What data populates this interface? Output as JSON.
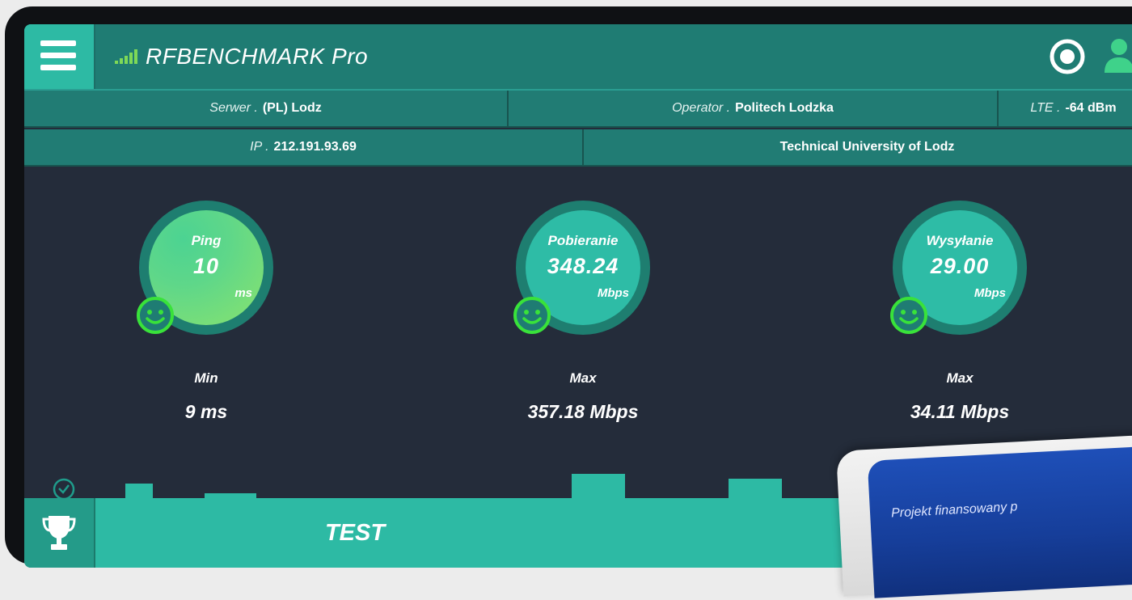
{
  "app": {
    "title": "RFBENCHMARK Pro"
  },
  "info": {
    "server_label": "Serwer .",
    "server_value": "(PL) Lodz",
    "operator_label": "Operator .",
    "operator_value": "Politech Lodzka",
    "network_label": "LTE .",
    "network_value": "-64 dBm",
    "ip_label": "IP .",
    "ip_value": "212.191.93.69",
    "isp_value": "Technical University of Lodz"
  },
  "gauges": [
    {
      "label": "Ping",
      "value": "10",
      "unit": "ms",
      "stat_label": "Min",
      "stat_value": "9 ms"
    },
    {
      "label": "Pobieranie",
      "value": "348.24",
      "unit": "Mbps",
      "stat_label": "Max",
      "stat_value": "357.18 Mbps"
    },
    {
      "label": "Wysyłanie",
      "value": "29.00",
      "unit": "Mbps",
      "stat_label": "Max",
      "stat_value": "34.11 Mbps"
    }
  ],
  "history": {
    "icon": "clock-icon"
  },
  "actions": {
    "test_label": "TEST",
    "trophy_icon": "trophy-icon"
  },
  "overlay": {
    "text": "Projekt finansowany p"
  },
  "colors": {
    "accent": "#2dbaa4",
    "header": "#1f7c73",
    "background": "#242c3a",
    "smiley": "#39e23a"
  }
}
